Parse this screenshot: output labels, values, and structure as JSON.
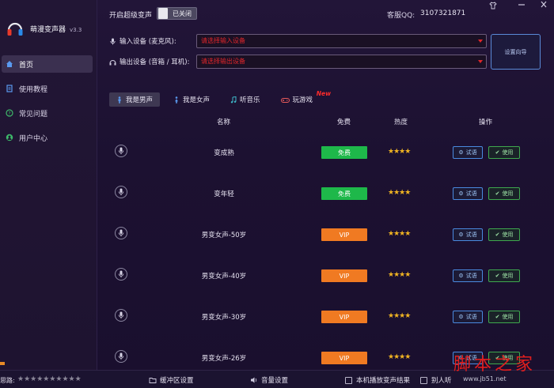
{
  "app": {
    "title": "萌漫变声器",
    "version": "v3.3"
  },
  "sidebar": {
    "items": [
      {
        "label": "首页",
        "icon": "home-icon",
        "active": true
      },
      {
        "label": "使用教程",
        "icon": "document-icon",
        "active": false
      },
      {
        "label": "常见问题",
        "icon": "question-icon",
        "active": false
      },
      {
        "label": "用户中心",
        "icon": "user-icon",
        "active": false
      }
    ]
  },
  "topbar": {
    "super_label": "开启超级变声",
    "toggle_text": "已关闭",
    "qq_label": "客服QQ:",
    "qq_value": "3107321871"
  },
  "devices": {
    "input_label": "输入设备 (麦克风):",
    "input_placeholder": "请选择输入设备",
    "output_label": "输出设备 (音箱 / 耳机):",
    "output_placeholder": "请选择输出设备",
    "setup_button": "设置向导"
  },
  "tabs": [
    {
      "label": "我是男声",
      "icon": "male-icon",
      "active": true
    },
    {
      "label": "我是女声",
      "icon": "female-icon",
      "active": false
    },
    {
      "label": "听音乐",
      "icon": "music-icon",
      "active": false
    },
    {
      "label": "玩游戏",
      "icon": "gamepad-icon",
      "active": false,
      "badge": "New"
    }
  ],
  "table": {
    "headers": {
      "name": "名称",
      "free": "免费",
      "hot": "热度",
      "action": "操作"
    },
    "try_label": "试语",
    "use_label": "使用",
    "rows": [
      {
        "name": "变成熟",
        "badge": "免费",
        "type": "free",
        "stars": "★★★★"
      },
      {
        "name": "变年轻",
        "badge": "免费",
        "type": "free",
        "stars": "★★★★"
      },
      {
        "name": "男变女声-50岁",
        "badge": "VIP",
        "type": "vip",
        "stars": "★★★★"
      },
      {
        "name": "男变女声-40岁",
        "badge": "VIP",
        "type": "vip",
        "stars": "★★★★"
      },
      {
        "name": "男变女声-30岁",
        "badge": "VIP",
        "type": "vip",
        "stars": "★★★★"
      },
      {
        "name": "男变女声-26岁",
        "badge": "VIP",
        "type": "vip",
        "stars": "★★★★"
      }
    ]
  },
  "bottom": {
    "rate_label": "思路:",
    "rate_stars": "★★★★★★★★★★",
    "buffer_label": "缓冲区设置",
    "volume_label": "音量设置",
    "local_play_label": "本机播放变声结果",
    "others_hear_label": "别人听"
  },
  "watermark": {
    "title": "脚本之家",
    "url": "www.jb51.net"
  },
  "colors": {
    "free": "#1eb84a",
    "vip": "#f07a22",
    "accent_red": "#e0262a",
    "star": "#f0b422"
  }
}
